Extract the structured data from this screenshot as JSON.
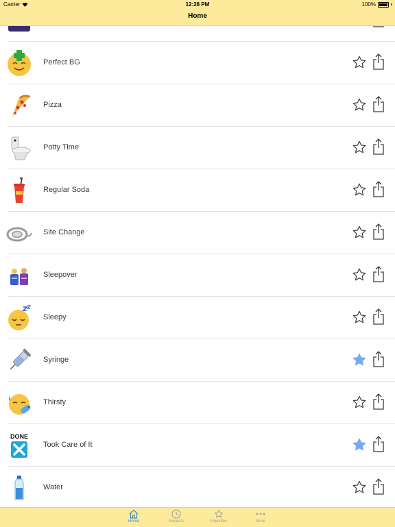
{
  "status_bar": {
    "carrier": "Carrier",
    "time": "12:28 PM",
    "battery": "100%"
  },
  "nav": {
    "title": "Home"
  },
  "items": [
    {
      "label": "",
      "icon": "purple-tile-icon",
      "favorite": false
    },
    {
      "label": "Perfect BG",
      "icon": "smiling-face-cross-icon",
      "favorite": false
    },
    {
      "label": "Pizza",
      "icon": "pizza-icon",
      "favorite": false
    },
    {
      "label": "Potty Time",
      "icon": "toilet-icon",
      "favorite": false
    },
    {
      "label": "Regular Soda",
      "icon": "soda-cup-icon",
      "favorite": false
    },
    {
      "label": "Site Change",
      "icon": "infusion-set-icon",
      "favorite": false
    },
    {
      "label": "Sleepover",
      "icon": "sleepover-icon",
      "favorite": false
    },
    {
      "label": "Sleepy",
      "icon": "sleepy-face-icon",
      "favorite": false
    },
    {
      "label": "Syringe",
      "icon": "syringe-icon",
      "favorite": true
    },
    {
      "label": "Thirsty",
      "icon": "thirsty-face-icon",
      "favorite": false
    },
    {
      "label": "Took Care of It",
      "icon": "done-x-icon",
      "favorite": true,
      "icon_text": "DONE"
    },
    {
      "label": "Water",
      "icon": "water-bottle-icon",
      "favorite": false
    }
  ],
  "tabs": [
    {
      "label": "Home",
      "icon": "house-icon",
      "active": true
    },
    {
      "label": "Recents",
      "icon": "clock-icon",
      "active": false
    },
    {
      "label": "Favorites",
      "icon": "star-icon",
      "active": false
    },
    {
      "label": "More",
      "icon": "ellipsis-icon",
      "active": false
    }
  ],
  "colors": {
    "bar_background": "#fdeb9b",
    "favorite_star": "#7aa7f5",
    "active_tab": "#3a8fc9"
  }
}
